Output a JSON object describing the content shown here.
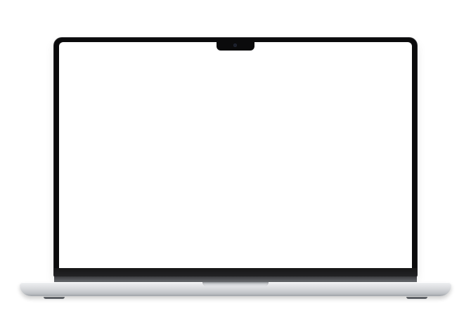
{
  "device": {
    "type": "laptop",
    "screen_state": "blank-white",
    "colors": {
      "bezel": "#0b0b0c",
      "screen": "#ffffff",
      "chassis": "#d8dadd"
    }
  }
}
